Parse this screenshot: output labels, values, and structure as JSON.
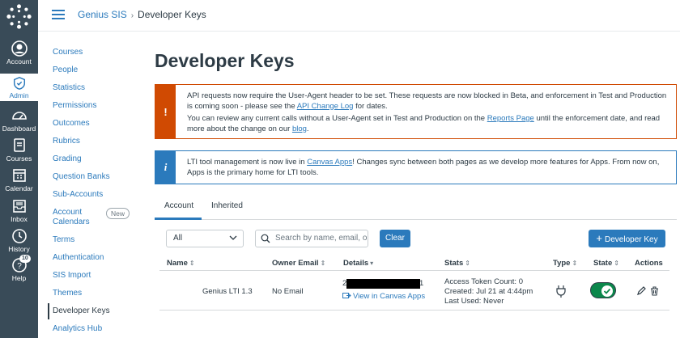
{
  "colors": {
    "nav_bg": "#394b58",
    "brand": "#2b7abc",
    "warning": "#d04a02",
    "success": "#0b874b"
  },
  "global_nav": {
    "items": [
      {
        "label": "Account",
        "icon": "avatar-icon"
      },
      {
        "label": "Admin",
        "icon": "shield-icon"
      },
      {
        "label": "Dashboard",
        "icon": "dashboard-icon"
      },
      {
        "label": "Courses",
        "icon": "courses-icon"
      },
      {
        "label": "Calendar",
        "icon": "calendar-icon"
      },
      {
        "label": "Inbox",
        "icon": "inbox-icon"
      },
      {
        "label": "History",
        "icon": "clock-icon"
      },
      {
        "label": "Help",
        "icon": "help-icon",
        "badge": "10"
      }
    ]
  },
  "breadcrumb": {
    "root": "Genius SIS",
    "current": "Developer Keys"
  },
  "course_nav": {
    "items": [
      "Courses",
      "People",
      "Statistics",
      "Permissions",
      "Outcomes",
      "Rubrics",
      "Grading",
      "Question Banks",
      "Sub-Accounts",
      "Account",
      "Calendars",
      "Terms",
      "Authentication",
      "SIS Import",
      "Themes",
      "Developer Keys",
      "Analytics Hub"
    ],
    "new_badge": "New"
  },
  "page": {
    "title": "Developer Keys",
    "alert_warning": {
      "icon": "!",
      "line1": "API requests now require the User-Agent header to be set. These requests are now blocked in Beta, and enforcement in Test and Production",
      "line2_prefix": "is coming soon - please see the ",
      "line2_link": "API Change Log",
      "line2_suffix": " for dates.",
      "line3_prefix": "You can review any current calls without a User-Agent set in Test and Production on the ",
      "line3_link": "Reports Page",
      "line3_suffix": " until the enforcement date, and read",
      "line4_prefix": "more about the change on our ",
      "line4_link": "blog",
      "line4_suffix": "."
    },
    "alert_info": {
      "icon": "i",
      "line1_prefix": "LTI tool management is now live in ",
      "line1_link": "Canvas Apps",
      "line1_suffix": "! Changes sync between both pages as we develop more features for Apps. From now on,",
      "line2": "Apps is the primary home for LTI tools."
    },
    "tabs": [
      "Account",
      "Inherited"
    ],
    "filter": {
      "selected": "All",
      "search_placeholder": "Search by name, email, or",
      "clear": "Clear",
      "add_key": "Developer Key"
    },
    "table": {
      "columns": [
        "Name",
        "Owner Email",
        "Details",
        "Stats",
        "Type",
        "State",
        "Actions"
      ],
      "rows": [
        {
          "name": "Genius LTI 1.3",
          "owner_email": "No Email",
          "details_prefix": "2",
          "details_suffix": "1",
          "details_link": "View in Canvas Apps",
          "stats": [
            "Access Token Count: 0",
            "Created: Jul 21 at 4:44pm",
            "Last Used: Never"
          ],
          "state": "on"
        }
      ]
    }
  }
}
